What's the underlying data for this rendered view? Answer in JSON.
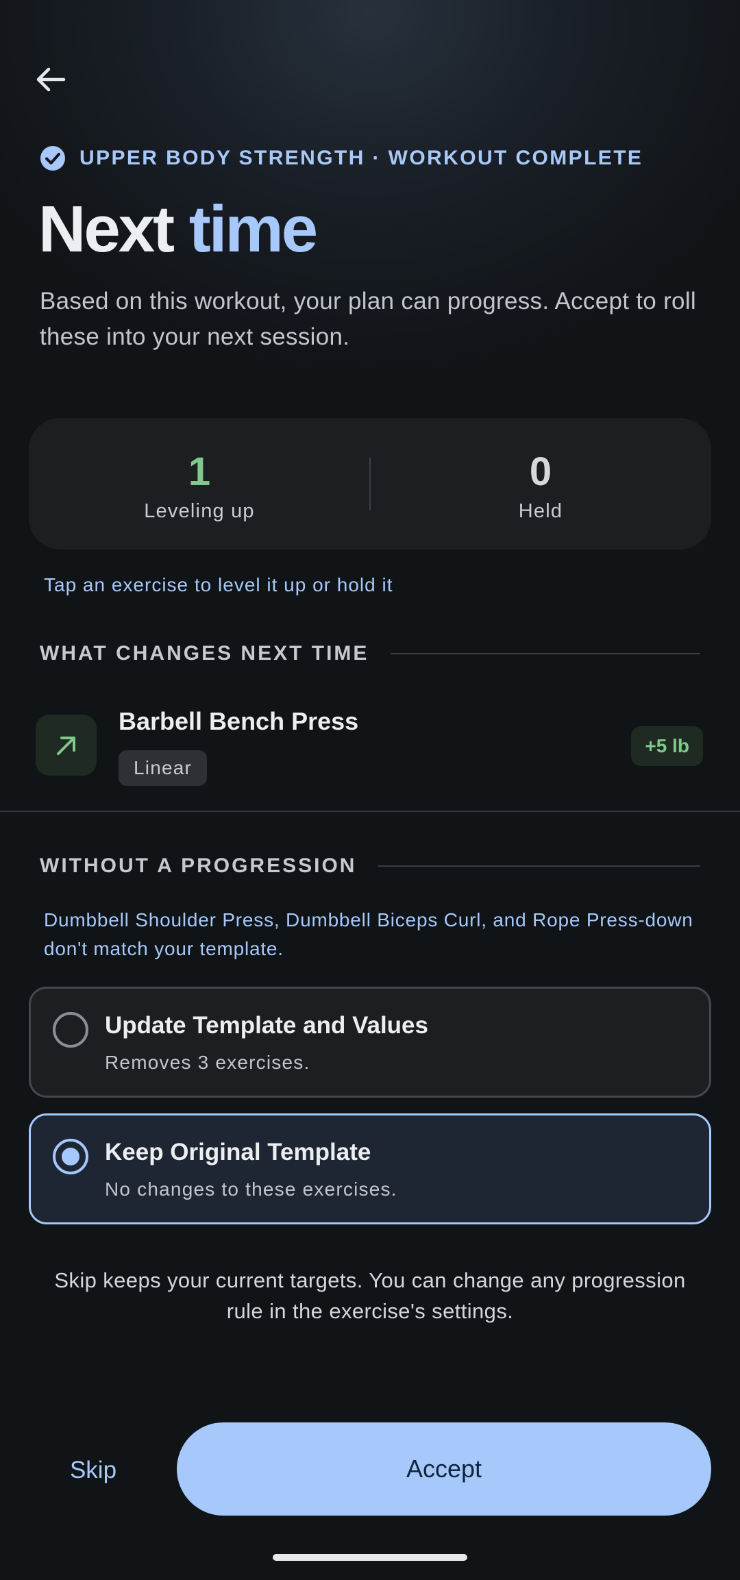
{
  "header": {
    "eyebrow": "UPPER BODY STRENGTH · WORKOUT COMPLETE",
    "title_part1": "Next",
    "title_part2": "time",
    "subtitle": "Based on this workout, your plan can progress. Accept to roll these into your next session."
  },
  "stats": [
    {
      "value": "1",
      "label": "Leveling up",
      "color": "#7fc98c"
    },
    {
      "value": "0",
      "label": "Held",
      "color": "#d6d8dc"
    }
  ],
  "hint": "Tap an exercise to level it up or hold it",
  "sections": {
    "changes_title": "WHAT CHANGES NEXT TIME",
    "without_title": "WITHOUT A PROGRESSION"
  },
  "exercise": {
    "name": "Barbell Bench Press",
    "tag": "Linear",
    "badge": "+5 lb",
    "icon": "arrow-up-right-icon"
  },
  "note": "Dumbbell Shoulder Press, Dumbbell Biceps Curl, and Rope Press-down don't match your template.",
  "options": [
    {
      "title": "Update Template and Values",
      "subtitle": "Removes 3 exercises.",
      "selected": false
    },
    {
      "title": "Keep Original Template",
      "subtitle": "No changes to these exercises.",
      "selected": true
    }
  ],
  "footer_note": "Skip keeps your current targets. You can change any progression rule in the exercise's settings.",
  "actions": {
    "skip": "Skip",
    "accept": "Accept"
  },
  "colors": {
    "accent": "#a6c8fa",
    "success": "#7fc98c",
    "background": "#111417"
  }
}
